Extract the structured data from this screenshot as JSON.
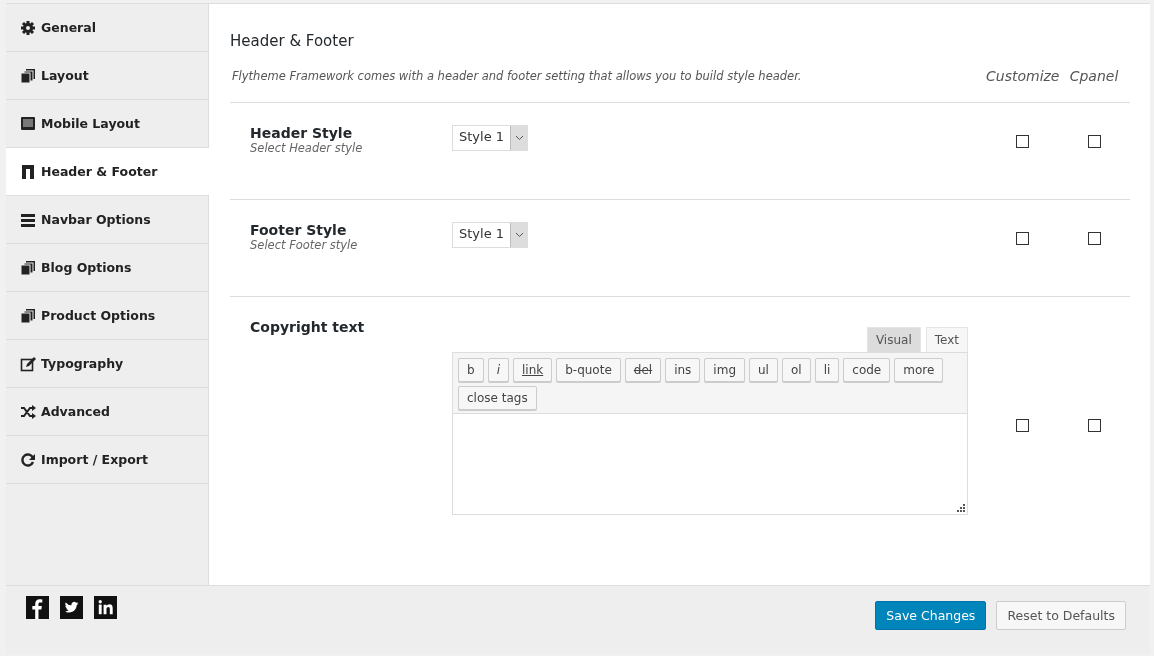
{
  "sidebar": {
    "items": [
      {
        "label": "General",
        "selected": false
      },
      {
        "label": "Layout",
        "selected": false
      },
      {
        "label": "Mobile Layout",
        "selected": false
      },
      {
        "label": "Header & Footer",
        "selected": true
      },
      {
        "label": "Navbar Options",
        "selected": false
      },
      {
        "label": "Blog Options",
        "selected": false
      },
      {
        "label": "Product Options",
        "selected": false
      },
      {
        "label": "Typography",
        "selected": false
      },
      {
        "label": "Advanced",
        "selected": false
      },
      {
        "label": "Import / Export",
        "selected": false
      }
    ]
  },
  "section": {
    "title": "Header & Footer",
    "description": "Flytheme Framework comes with a header and footer setting that allows you to build style header.",
    "columns": [
      "Customize",
      "Cpanel"
    ]
  },
  "options": [
    {
      "kind": "select",
      "label": "Header Style",
      "hint": "Select Header style",
      "value": "Style 1",
      "customize": false,
      "cpanel": false
    },
    {
      "kind": "select",
      "label": "Footer Style",
      "hint": "Select Footer style",
      "value": "Style 1",
      "customize": false,
      "cpanel": false
    },
    {
      "kind": "editor",
      "label": "Copyright text",
      "customize": false,
      "cpanel": false,
      "tabs": [
        {
          "label": "Visual",
          "selected": false
        },
        {
          "label": "Text",
          "selected": true
        }
      ],
      "buttons": [
        {
          "label": "b",
          "kind": "plain"
        },
        {
          "label": "i",
          "kind": "italic"
        },
        {
          "label": "link",
          "kind": "underline"
        },
        {
          "label": "b-quote",
          "kind": "plain"
        },
        {
          "label": "del",
          "kind": "strike"
        },
        {
          "label": "ins",
          "kind": "plain"
        },
        {
          "label": "img",
          "kind": "plain"
        },
        {
          "label": "ul",
          "kind": "plain"
        },
        {
          "label": "ol",
          "kind": "plain"
        },
        {
          "label": "li",
          "kind": "plain"
        },
        {
          "label": "code",
          "kind": "plain"
        },
        {
          "label": "more",
          "kind": "plain"
        },
        {
          "label": "close tags",
          "kind": "plain"
        }
      ]
    }
  ],
  "footer": {
    "buttons": [
      {
        "label": "Save Changes",
        "kind": "primary"
      },
      {
        "label": "Reset to Defaults",
        "kind": "secondary"
      }
    ]
  }
}
